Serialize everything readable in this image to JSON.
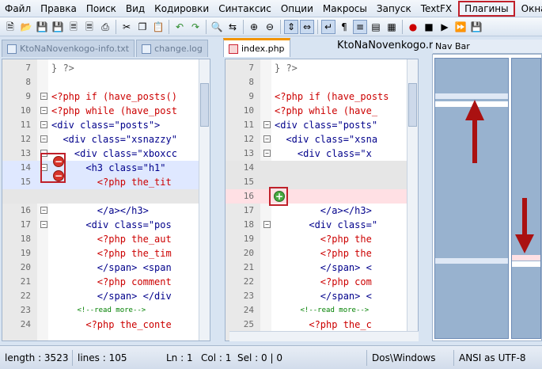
{
  "menu": [
    "Файл",
    "Правка",
    "Поиск",
    "Вид",
    "Кодировки",
    "Синтаксис",
    "Опции",
    "Макросы",
    "Запуск",
    "TextFX",
    "Плагины",
    "Окна",
    "?"
  ],
  "menu_highlighted": "Плагины",
  "tabs_left": [
    {
      "label": "KtoNaNovenkogo-info.txt",
      "active": false
    },
    {
      "label": "change.log",
      "active": false
    }
  ],
  "tabs_right": [
    {
      "label": "index.php",
      "active": true
    }
  ],
  "site_label": "KtoNaNovenkogo.ru",
  "nav_bar_title": "Nav Bar",
  "editor_left": {
    "lines": [
      {
        "num": "7",
        "code": "} ?>",
        "style": "dim"
      },
      {
        "num": "8",
        "code": "",
        "style": ""
      },
      {
        "num": "9",
        "code": "<?php if (have_posts()",
        "style": "php"
      },
      {
        "num": "10",
        "code": "<?php while (have_post",
        "style": "php"
      },
      {
        "num": "11",
        "code": "<div class=\"posts\">",
        "style": "tag"
      },
      {
        "num": "12",
        "code": "  <div class=\"xsnazzy\"",
        "style": "tag"
      },
      {
        "num": "13",
        "code": "    <div class=\"xboxcc",
        "style": "tag"
      },
      {
        "num": "14",
        "code": "      <h3 class=\"h1\"",
        "style": "tag"
      },
      {
        "num": "15",
        "code": "        <?php the_tit",
        "style": "php"
      },
      {
        "num": "",
        "code": "",
        "style": ""
      },
      {
        "num": "16",
        "code": "        </a></h3>",
        "style": "tag"
      },
      {
        "num": "17",
        "code": "      <div class=\"pos",
        "style": "tag"
      },
      {
        "num": "18",
        "code": "        <?php the_aut",
        "style": "php"
      },
      {
        "num": "19",
        "code": "        <?php the_tim",
        "style": "php"
      },
      {
        "num": "20",
        "code": "        </span> <span",
        "style": "tag"
      },
      {
        "num": "21",
        "code": "        <?php comment",
        "style": "php"
      },
      {
        "num": "22",
        "code": "        </span> </div",
        "style": "tag"
      },
      {
        "num": "23",
        "code": "      <!--read more-->",
        "style": "cmt"
      },
      {
        "num": "24",
        "code": "      <?php the_conte",
        "style": "php"
      }
    ]
  },
  "editor_right": {
    "lines": [
      {
        "num": "7",
        "code": "} ?>",
        "style": "dim"
      },
      {
        "num": "8",
        "code": "",
        "style": ""
      },
      {
        "num": "9",
        "code": "<?php if (have_posts",
        "style": "php"
      },
      {
        "num": "10",
        "code": "<?php while (have_",
        "style": "php"
      },
      {
        "num": "11",
        "code": "<div class=\"posts\"",
        "style": "tag"
      },
      {
        "num": "12",
        "code": "  <div class=\"xsna",
        "style": "tag"
      },
      {
        "num": "13",
        "code": "    <div class=\"x",
        "style": "tag"
      },
      {
        "num": "14",
        "code": "",
        "style": ""
      },
      {
        "num": "15",
        "code": "",
        "style": ""
      },
      {
        "num": "16",
        "code": "",
        "style": ""
      },
      {
        "num": "17",
        "code": "        </a></h3>",
        "style": "tag"
      },
      {
        "num": "18",
        "code": "      <div class=\"",
        "style": "tag"
      },
      {
        "num": "19",
        "code": "        <?php the",
        "style": "php"
      },
      {
        "num": "20",
        "code": "        <?php the",
        "style": "php"
      },
      {
        "num": "21",
        "code": "        </span> <",
        "style": "tag"
      },
      {
        "num": "22",
        "code": "        <?php com",
        "style": "php"
      },
      {
        "num": "23",
        "code": "        </span> <",
        "style": "tag"
      },
      {
        "num": "24",
        "code": "      <!--read more-->",
        "style": "cmt"
      },
      {
        "num": "25",
        "code": "      <?php the_c",
        "style": "php"
      }
    ]
  },
  "status": {
    "length": "length : 3523",
    "lines": "lines : 105",
    "ln": "Ln : 1",
    "col": "Col : 1",
    "sel": "Sel : 0 | 0",
    "eol": "Dos\\Windows",
    "encoding": "ANSI as UTF-8"
  },
  "colors": {
    "accent_red": "#c0202a",
    "tab_active_top": "#f29400",
    "nav_column": "#98b2cf"
  }
}
